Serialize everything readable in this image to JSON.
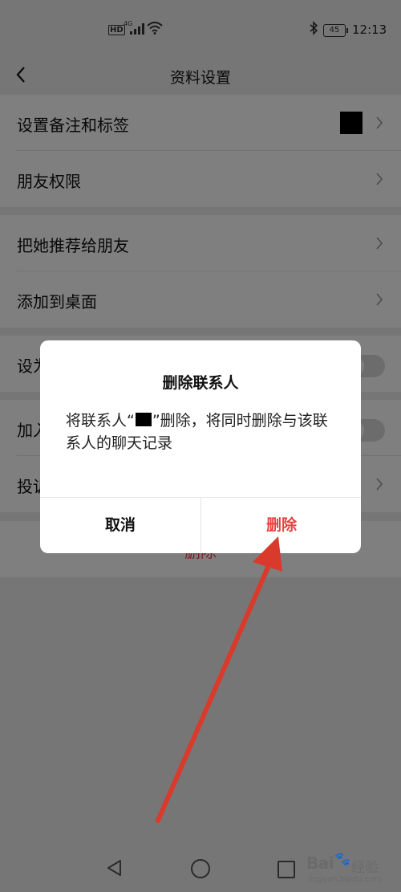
{
  "status_bar": {
    "hd": "HD",
    "network": "4G",
    "battery": "45",
    "time": "12:13"
  },
  "header": {
    "title": "资料设置"
  },
  "settings": {
    "set_remark": "设置备注和标签",
    "friend_permissions": "朋友权限",
    "recommend_to_friends": "把她推荐给朋友",
    "add_to_desktop": "添加到桌面",
    "row5_label_partial": "设为",
    "row6_label_partial": "加入",
    "row7_label_partial": "投诉",
    "delete_button": "删除"
  },
  "dialog": {
    "title": "删除联系人",
    "message_prefix": "将联系人“",
    "message_suffix": "”删除，将同时删除与该联系人的聊天记录",
    "cancel": "取消",
    "confirm": "删除"
  },
  "colors": {
    "danger": "#e64340",
    "arrow": "#d93a2b"
  },
  "watermark": {
    "brand": "Bai",
    "brand_cn": "经验",
    "url": "jingyan.baidu.com"
  }
}
